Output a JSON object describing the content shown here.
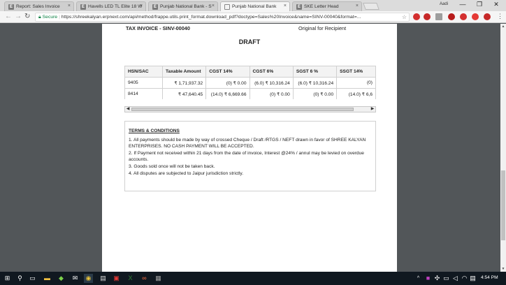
{
  "browser": {
    "tabs": [
      {
        "label": "Report: Sales Invoice",
        "icon": "E",
        "active": false
      },
      {
        "label": "Havells LED TL Elite 18 W",
        "icon": "E",
        "active": false
      },
      {
        "label": "Punjab National Bank - S",
        "icon": "E",
        "active": false
      },
      {
        "label": "Punjab National Bank",
        "icon": "doc",
        "active": true
      },
      {
        "label": "SKE Letter Head",
        "icon": "E",
        "active": false
      }
    ],
    "close_glyph": "×",
    "user_label": "Aadi",
    "window_controls": {
      "minimize": "—",
      "restore": "❐",
      "close": "✕"
    },
    "nav": {
      "back": "←",
      "forward": "→",
      "reload": "↻"
    },
    "secure_label": "Secure",
    "url": "https://shreekalyan.erpnext.com/api/method/frappe.utils.print_format.download_pdf?doctype=Sales%20Invoice&name=SINV-00040&format=..."
  },
  "document": {
    "header_left": "TAX INVOICE - SINV-00040",
    "header_right": "Original for Recipient",
    "status": "DRAFT",
    "tax_table": {
      "headers": [
        "HSN/SAC",
        "Taxable Amount",
        "CGST 14%",
        "CGST 6%",
        "SGST 6 %",
        "SSGT 14%"
      ],
      "rows": [
        [
          "9405",
          "₹ 1,71,937.32",
          "(0) ₹ 0.00",
          "(6.0) ₹ 10,316.24",
          "(6.0) ₹ 10,316.24",
          "(0)"
        ],
        [
          "8414",
          "₹ 47,640.45",
          "(14.0) ₹ 6,669.66",
          "(0) ₹ 0.00",
          "(0) ₹ 0.00",
          "(14.0) ₹ 6,6"
        ]
      ]
    },
    "terms": {
      "title": "TERMS & CONDITIONS",
      "items": [
        "1. All payments should be made by way of crossed Cheque / Draft /RTGS / NEFT drawn in favor of SHREE KALYAN ENTERPRISES. NO CASH PAYMENT WILL BE ACCEPTED.",
        "2. If Payment not received within 21 days from the date of invoice, Interest @24% / annul may be levied on overdue accounts.",
        "3. Goods sold once will not be taken back.",
        "4. All disputes are subjected to Jaipur jurisdiction strictly."
      ]
    }
  },
  "taskbar": {
    "time": "4:54 PM"
  },
  "colors": {
    "viewer_bg": "#525659",
    "secure_green": "#0b8043",
    "taskbar_bg": "#101820"
  }
}
